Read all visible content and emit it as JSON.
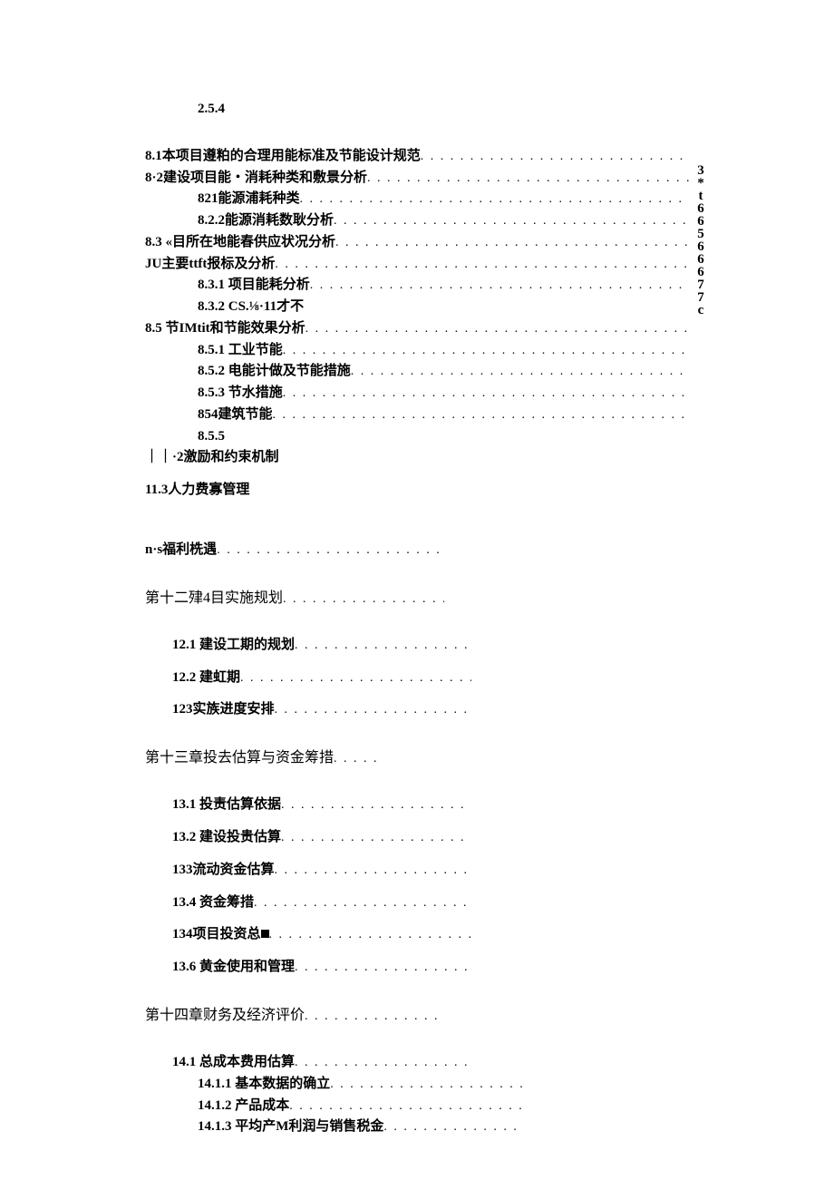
{
  "toc": {
    "e254": "2.5.4",
    "e81": "8.1本项目遵粕的合理用能标准及节能设计规范",
    "e82": "8·2建设项目能・消耗种类和敷景分析",
    "e821": "821能源浦耗种类",
    "e822": "8.2.2能源消耗数耿分析",
    "e83": "8.3  «目所在地能春供应状况分析",
    "eju": "JU主要ttft报标及分析",
    "e831": "8.3.1  项目能耗分析",
    "e832": "8.3.2  CS.⅛·11才不",
    "e85": "8.5  节IMtit和节能效果分析",
    "e851": "8.5.1  工业节能",
    "e852": "8.5.2  电能计做及节能措施",
    "e853": "8.5.3  节水措施",
    "e854": "854建筑节能",
    "e855": "8.5.5",
    "e112": "｜｜·2激励和约束机制",
    "e113": "11.3人力费寡管理",
    "ens": "n·s福利㭠遇",
    "ch12": "第十二肂4目实施规划",
    "e121": "12.1  建设工期的规划",
    "e122": "12.2  建虹期",
    "e123": "123实族进度安排",
    "ch13": "第十三章投去估算与资金筹措",
    "e131": "13.1  投责估算依据",
    "e132": "13.2  建设投贵估算",
    "e133": "133流动资金估算",
    "e134": "13.4  资金筹措",
    "e134b_pre": "134项目投资总",
    "e136": "13.6  黄金使用和管理",
    "ch14": "第十四章财务及经济评价",
    "e141": "14.1  总成本费用估算",
    "e1411": "14.1.1  基本数据的确立",
    "e1412": "14.1.2  产品成本",
    "e1413": "14.1.3  平均产M利润与销售税金"
  },
  "side_numbers": "3*t66566677c"
}
